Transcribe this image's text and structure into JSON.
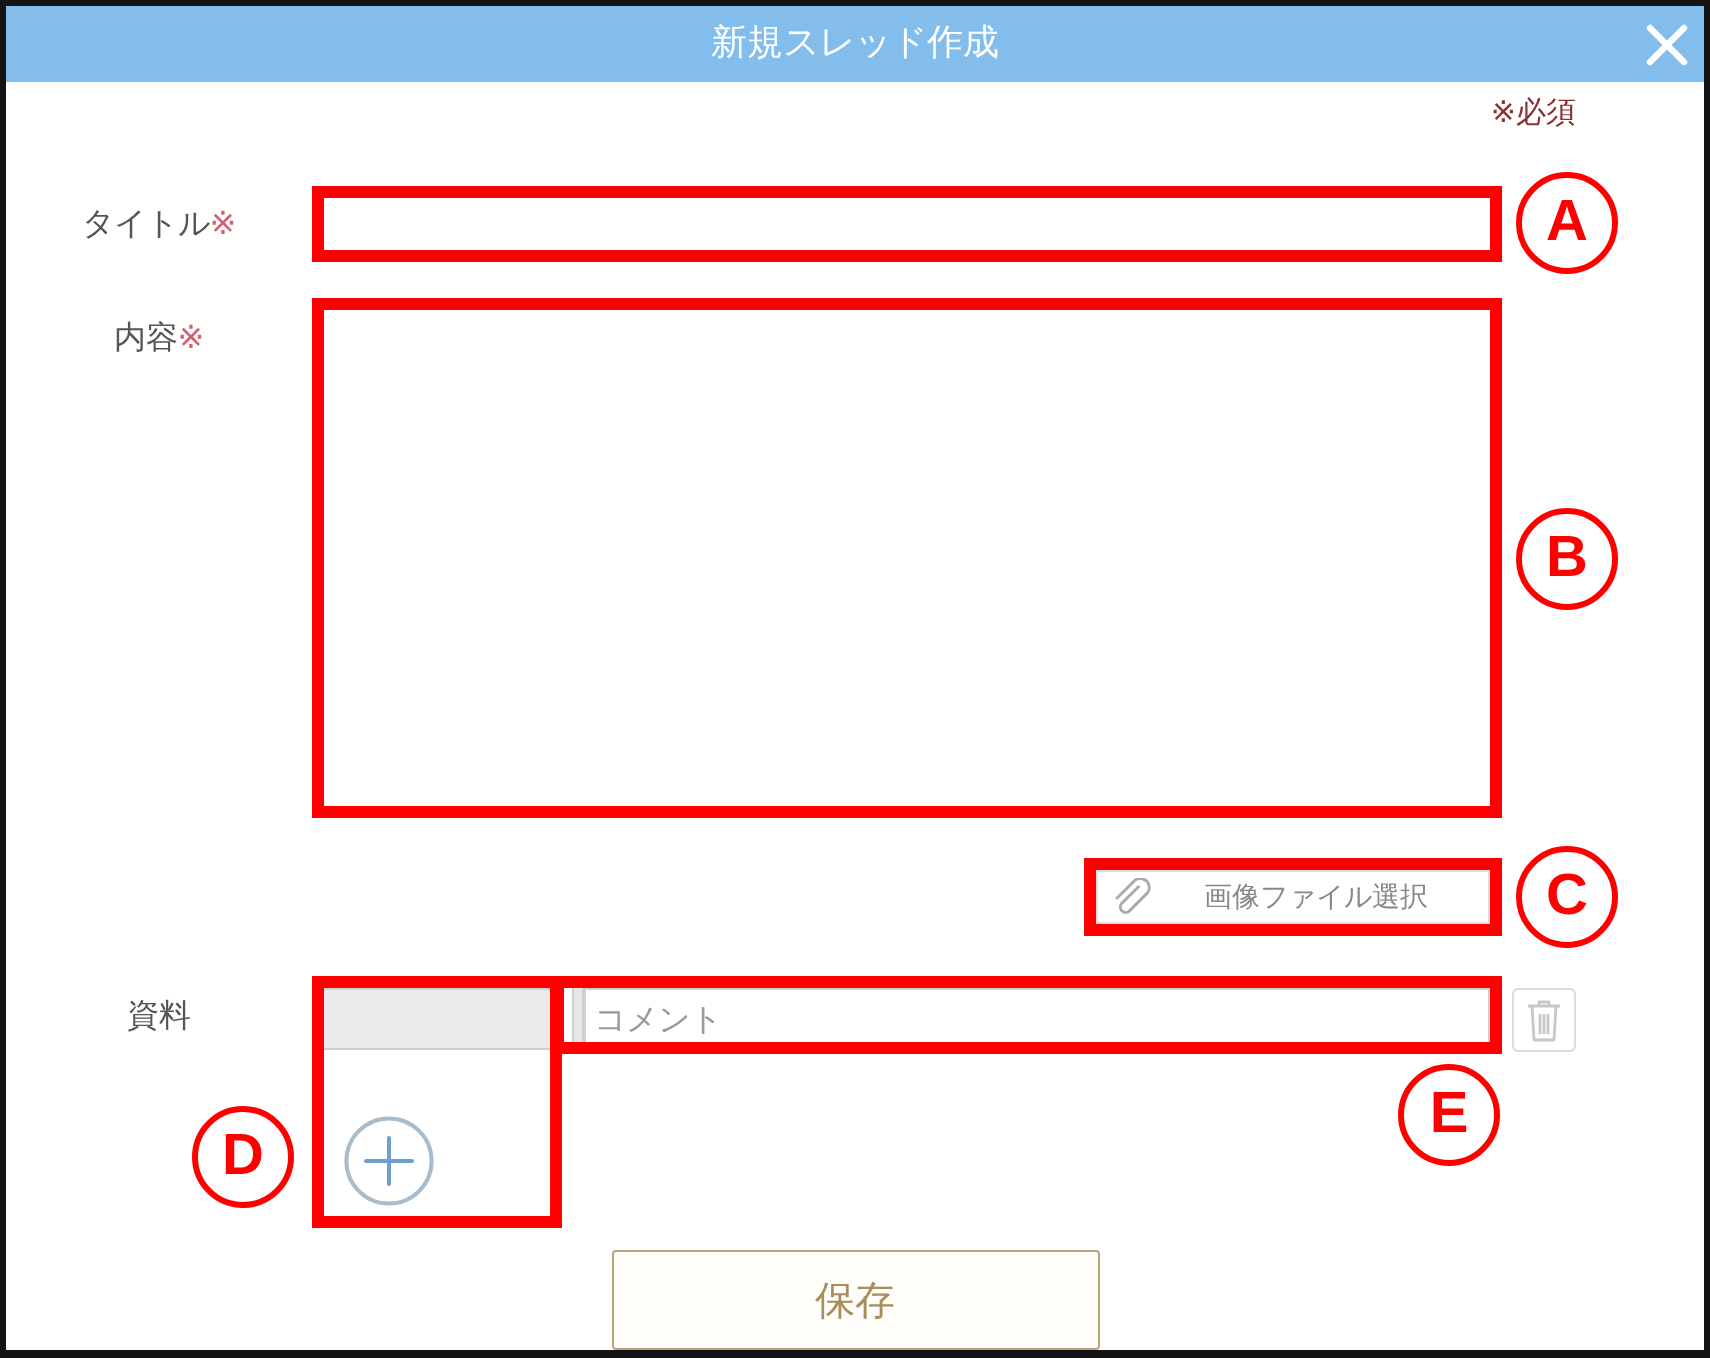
{
  "dialog": {
    "title": "新規スレッド作成"
  },
  "required_note": "※必須",
  "fields": [
    {
      "kind": "text",
      "label": "タイトル",
      "required_mark": "※",
      "callout": "A"
    },
    {
      "kind": "textarea",
      "label": "内容",
      "required_mark": "※",
      "callout": "B"
    }
  ],
  "image_select": {
    "label": "画像ファイル選択",
    "callout": "C"
  },
  "attachments": {
    "label": "資料",
    "add_callout": "D",
    "comment": {
      "placeholder": "コメント",
      "callout": "E"
    },
    "delete_button": {
      "disabled": true
    }
  },
  "save_button": {
    "label": "保存"
  }
}
